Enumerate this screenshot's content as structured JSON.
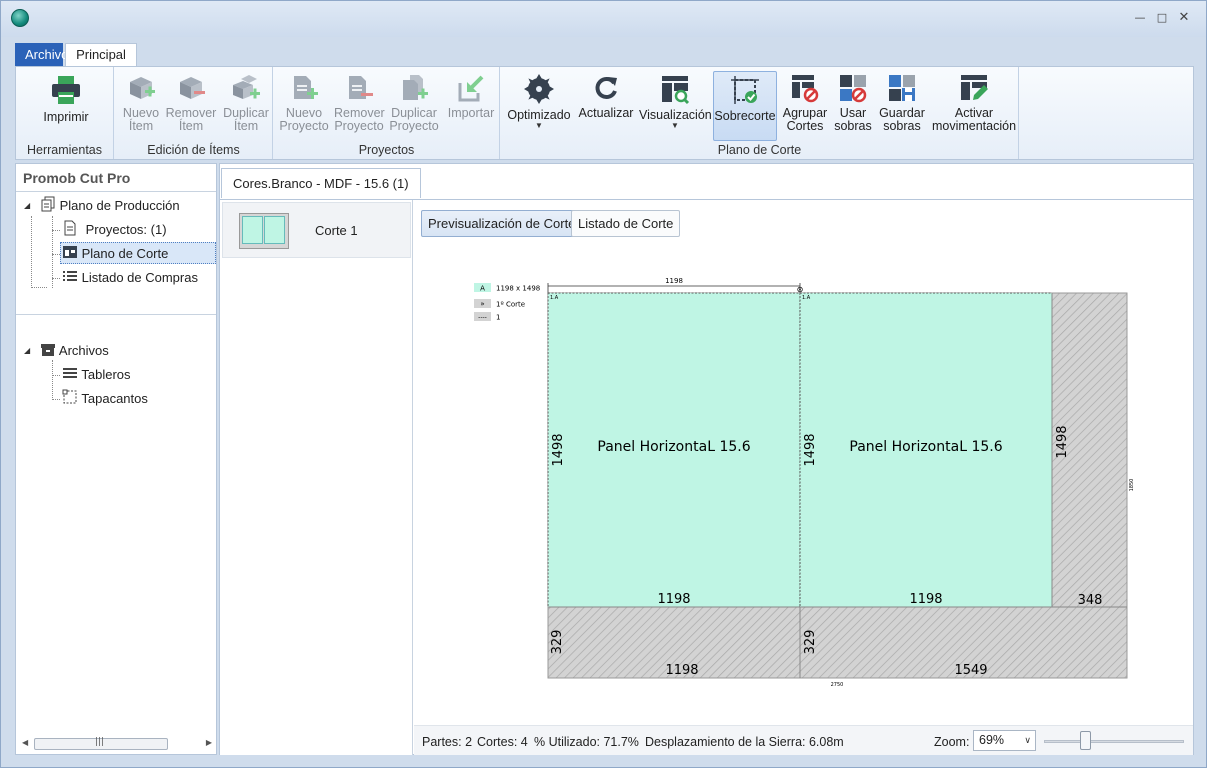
{
  "ribbon_tabs": [
    "Archivo",
    "Principal"
  ],
  "groups": {
    "herramientas": {
      "label": "Herramientas",
      "buttons": {
        "imprimir": "Imprimir"
      }
    },
    "edicion": {
      "label": "Edición de Ítems",
      "buttons": {
        "nuevo": "Nuevo\nÍtem",
        "remover": "Remover\nÍtem",
        "duplicar": "Duplicar\nÍtem"
      }
    },
    "proyectos": {
      "label": "Proyectos",
      "buttons": {
        "nuevo": "Nuevo\nProyecto",
        "remover": "Remover\nProyecto",
        "duplicar": "Duplicar\nProyecto",
        "importar": "Importar"
      }
    },
    "plano": {
      "label": "Plano de Corte",
      "buttons": {
        "optimizado": "Optimizado",
        "actualizar": "Actualizar",
        "visualizacion": "Visualización",
        "sobrecorte": "Sobrecorte",
        "agrupar": "Agrupar\nCortes",
        "usar": "Usar\nsobras",
        "guardar": "Guardar\nsobras",
        "activar": "Activar\nmovimentación"
      }
    }
  },
  "left_panel": {
    "title": "Promob Cut Pro",
    "tree": {
      "plano_produccion": "Plano de Producción",
      "proyectos": "Proyectos: (1)",
      "plano_corte": "Plano de Corte",
      "listado_compras": "Listado de Compras",
      "archivos": "Archivos",
      "tableros": "Tableros",
      "tapacantos": "Tapacantos"
    }
  },
  "document_tab": "Cores.Branco - MDF - 15.6 (1)",
  "cuts": [
    {
      "label": "Corte 1"
    }
  ],
  "view_buttons": {
    "preview": "Previsualización de Corte",
    "list": "Listado de Corte"
  },
  "cut_plan": {
    "legend": {
      "a_key": "A",
      "a_value": "1198 x 1498",
      "cut_key": "»",
      "cut_value": "1º Corte",
      "line_key": "----",
      "line_value": "1"
    },
    "board_width": "2750",
    "board_height": "1850",
    "top_dimension": "1198",
    "pieces": [
      {
        "name": "Panel HorizontaL 15.6",
        "tag": "1.A",
        "width": "1198",
        "height": "1498"
      },
      {
        "name": "Panel HorizontaL 15.6",
        "tag": "1.A",
        "width": "1198",
        "height": "1498"
      }
    ],
    "scraps": [
      {
        "width": "348",
        "height": "1498"
      },
      {
        "width": "1198",
        "height": "329"
      },
      {
        "width": "1549",
        "height": "329"
      }
    ]
  },
  "status": {
    "partes": "Partes: 2",
    "cortes": "Cortes: 4",
    "utilizado": "% Utilizado: 71.7%",
    "desplazamiento": "Desplazamiento de la Sierra: 6.08m",
    "zoom_label": "Zoom:",
    "zoom_value": "69%",
    "zoom_level": 0.3
  },
  "colors": {
    "piece": "#bff5e4",
    "scrap": "#d3d3d3",
    "accent": "#2b62b8"
  }
}
